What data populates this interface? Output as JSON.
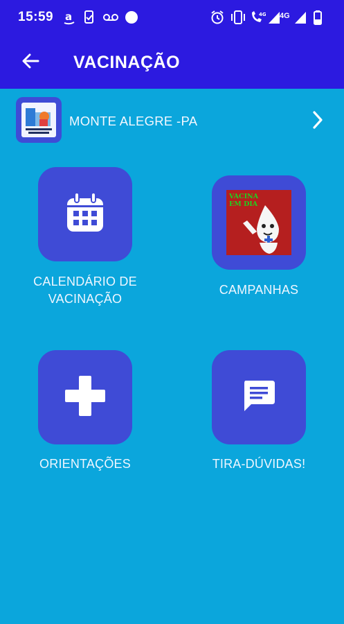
{
  "status_bar": {
    "time": "15:59",
    "network": "4G",
    "left_icons": [
      "amazon-icon",
      "device-check-icon",
      "voicemail-icon",
      "circle-notification-icon"
    ],
    "right_icons": [
      "alarm-icon",
      "vibrate-icon",
      "wifi-call-icon",
      "signal-icon",
      "signal-icon",
      "battery-icon"
    ]
  },
  "app_bar": {
    "title": "VACINAÇÃO",
    "back_icon": "arrow-left-icon",
    "color": "#2c1ae0"
  },
  "location": {
    "name": "MONTE ALEGRE -PA",
    "logo_icon": "municipality-logo",
    "chevron_icon": "chevron-right-icon"
  },
  "menu": {
    "calendar": {
      "label": "CALENDÁRIO DE\nVACINAÇÃO",
      "icon": "calendar-icon"
    },
    "campaigns": {
      "label": "CAMPANHAS",
      "image_text": "VACINA\nEM DIA"
    },
    "guidelines": {
      "label": "ORIENTAÇÕES",
      "icon": "plus-icon"
    },
    "faq": {
      "label": "TIRA-DÚVIDAS!",
      "icon": "message-icon"
    }
  },
  "colors": {
    "background": "#0ba6dc",
    "tile": "#3f4bd6"
  }
}
